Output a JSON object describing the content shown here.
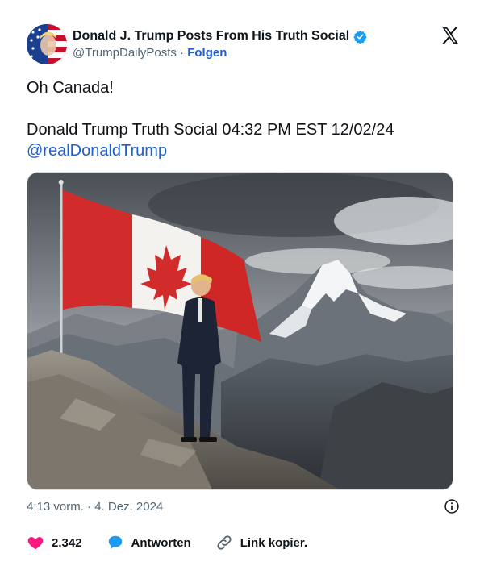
{
  "author": {
    "name": "Donald J. Trump Posts From His Truth Social",
    "handle": "@TrumpDailyPosts",
    "separator": "·",
    "follow_label": "Folgen"
  },
  "tweet": {
    "line1": "Oh Canada!",
    "line2": "Donald Trump Truth Social 04:32 PM EST 12/02/24",
    "mention": "@realDonaldTrump"
  },
  "meta": {
    "time": "4:13 vorm.",
    "separator": "·",
    "date": "4. Dez. 2024"
  },
  "actions": {
    "likes": "2.342",
    "reply_label": "Antworten",
    "copy_link_label": "Link kopier."
  },
  "icons": {
    "verified": "verified-badge-icon",
    "x_logo": "x-logo-icon",
    "info": "info-icon",
    "like": "heart-icon",
    "reply": "reply-bubble-icon",
    "link": "link-icon"
  },
  "colors": {
    "accent": "#1d5fd1",
    "verified": "#1d9bf0",
    "like": "#f91880",
    "muted": "#536471",
    "text": "#0f1419"
  }
}
